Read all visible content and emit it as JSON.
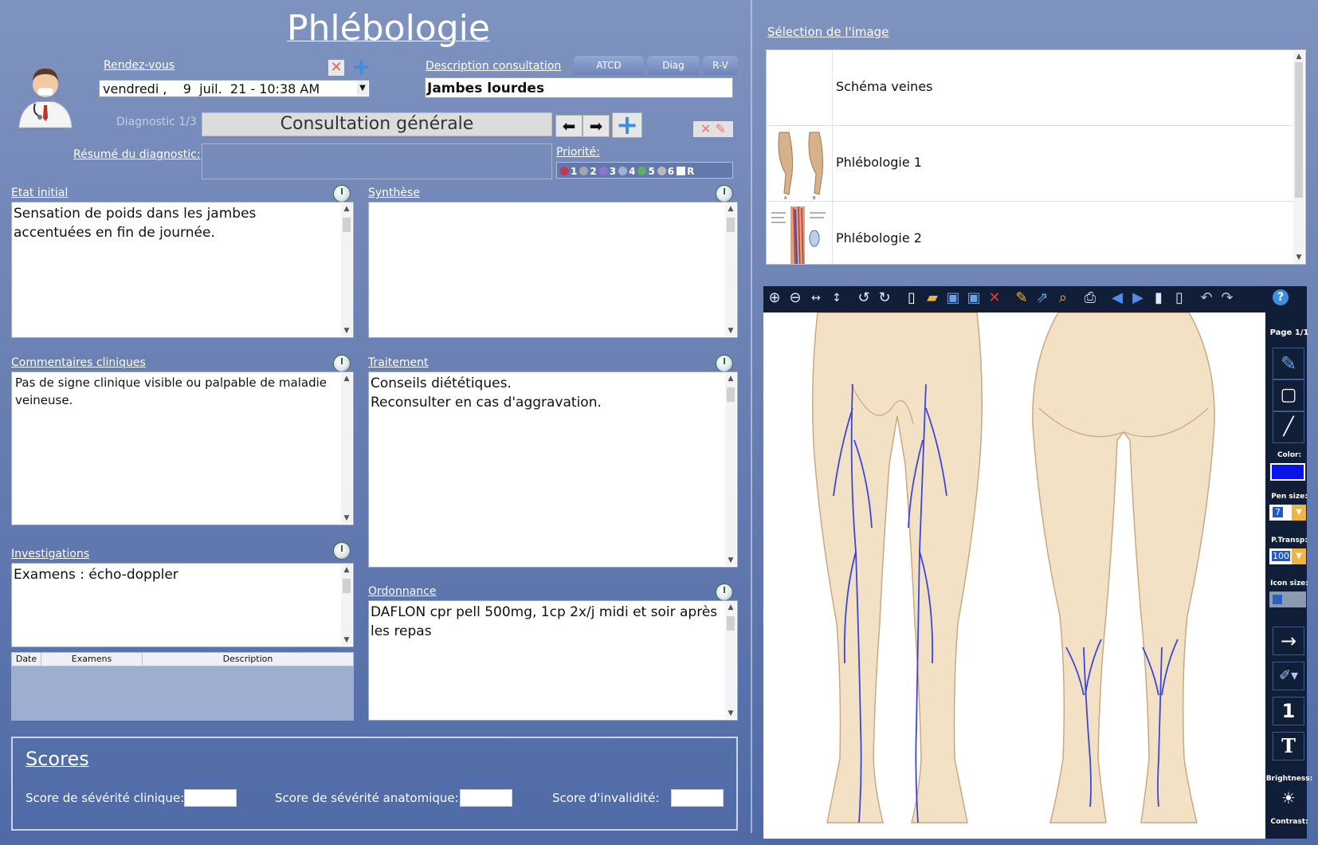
{
  "app": {
    "title": "Phlébologie"
  },
  "rdv": {
    "label": "Rendez-vous",
    "value": "vendredi ,    9  juil.  21 - 10:38 AM"
  },
  "description": {
    "label": "Description consultation",
    "value": "Jambes lourdes"
  },
  "tabs": [
    "ATCD",
    "Diag",
    "R-V"
  ],
  "diagnostic": {
    "label": "Diagnostic 1/3",
    "value": "Consultation générale",
    "summary_label": "Résumé du diagnostic:"
  },
  "priority": {
    "label": "Priorité:",
    "levels": [
      "1",
      "2",
      "3",
      "4",
      "5",
      "6"
    ],
    "r_label": "R",
    "colors": [
      "#c0395a",
      "#9a9a9a",
      "#8a78c8",
      "#8aa0c8",
      "#5fae6a",
      "#b0b0b0"
    ]
  },
  "etat_initial": {
    "label": "Etat initial",
    "text": "Sensation de poids dans les jambes accentuées en fin de journée."
  },
  "synthese": {
    "label": "Synthèse",
    "text": ""
  },
  "commentaires": {
    "label": "Commentaires cliniques",
    "text": "Pas de signe clinique visible ou palpable de maladie veineuse."
  },
  "traitement": {
    "label": "Traitement",
    "line1": "Conseils diététiques.",
    "line2": "Reconsulter en cas d'aggravation."
  },
  "investigations": {
    "label": "Investigations",
    "text": "Examens : écho-doppler",
    "columns": [
      "Date",
      "Examens",
      "Description"
    ]
  },
  "ordonnance": {
    "label": "Ordonnance",
    "text": "DAFLON cpr pell 500mg, 1cp 2x/j midi et soir après les repas"
  },
  "scores": {
    "title": "Scores",
    "clinique": "Score de sévérité clinique:",
    "anatomique": "Score de sévérité anatomique:",
    "invalidite": "Score d'invalidité:"
  },
  "image_selection": {
    "label": "Sélection de l'image",
    "items": [
      "Schéma veines",
      "Phlébologie 1",
      "Phlébologie 2"
    ]
  },
  "viewer": {
    "page_label": "Page 1/1",
    "color_label": "Color:",
    "pen_color": "#0a14e6",
    "pen_size_label": "Pen size:",
    "pen_size": "7",
    "transp_label": "P.Transp:",
    "transp": "100",
    "icon_size_label": "Icon size:",
    "brightness_label": "Brightness:",
    "contrast_label": "Contrast:",
    "number_tool": "1",
    "text_tool": "T",
    "help": "?"
  }
}
